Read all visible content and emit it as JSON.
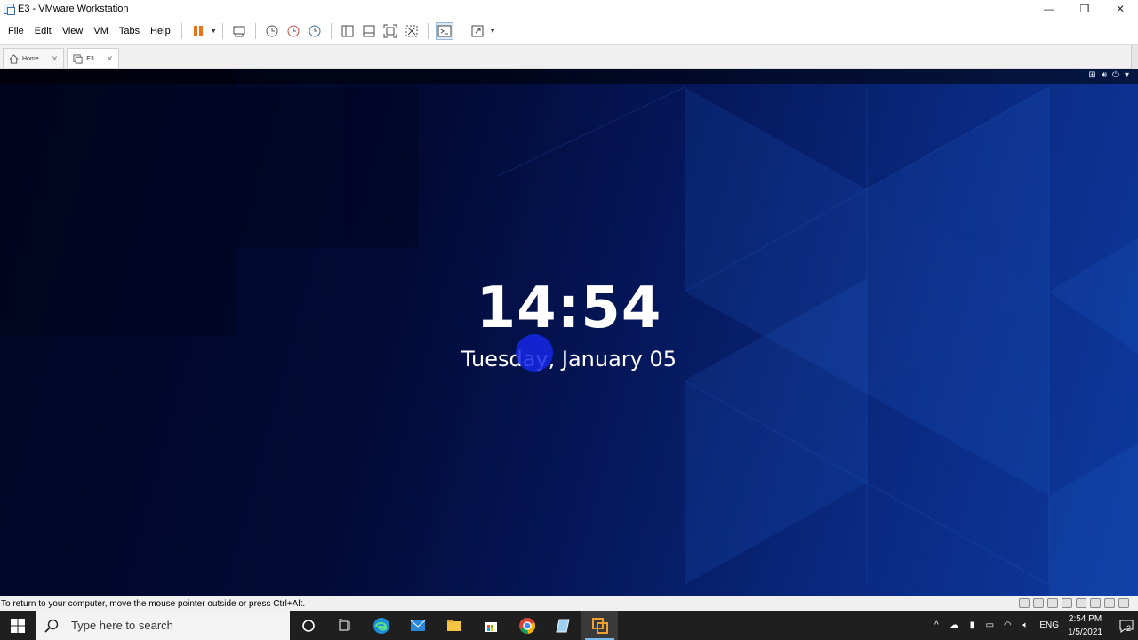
{
  "window": {
    "title": "E3 - VMware Workstation"
  },
  "menu": [
    "File",
    "Edit",
    "View",
    "VM",
    "Tabs",
    "Help"
  ],
  "tabs": [
    {
      "label": "Home",
      "icon": "home-icon"
    },
    {
      "label": "E3",
      "icon": "vm-icon"
    }
  ],
  "vm_screen": {
    "time": "14:54",
    "date": "Tuesday, January 05"
  },
  "status": {
    "message": "To return to your computer, move the mouse pointer outside or press Ctrl+Alt."
  },
  "taskbar": {
    "search_placeholder": "Type here to search",
    "language": "ENG",
    "time": "2:54 PM",
    "date": "1/5/2021",
    "notification_count": "2"
  },
  "colors": {
    "pause_accent": "#e8731a",
    "taskbar_bg": "#1f1f1f"
  }
}
